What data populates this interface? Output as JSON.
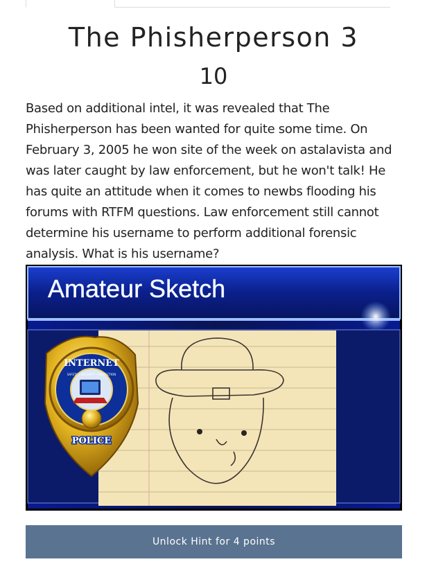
{
  "challenge": {
    "title": "The Phisherperson 3",
    "points": "10",
    "description": "Based on additional intel, it was revealed that The Phisherperson has been wanted for quite some time. On February 3, 2005 he won site of the week on astalavista and was later caught by law enforcement, but he won't talk! He has quite an attitude when it comes to newbs flooding his forums with RTFM questions. Law enforcement still cannot determine his username to perform additional forensic analysis. What is his username?"
  },
  "image": {
    "banner_text": "Amateur Sketch",
    "badge_top": "INTERNET",
    "badge_ring": "SAFETY • SECURITY • PROTECTION",
    "badge_bottom": "POLICE"
  },
  "hint_button": {
    "label": "Unlock Hint for 4 points"
  },
  "colors": {
    "button_bg": "#5a7390",
    "banner_bg": "#0b1f8a"
  }
}
